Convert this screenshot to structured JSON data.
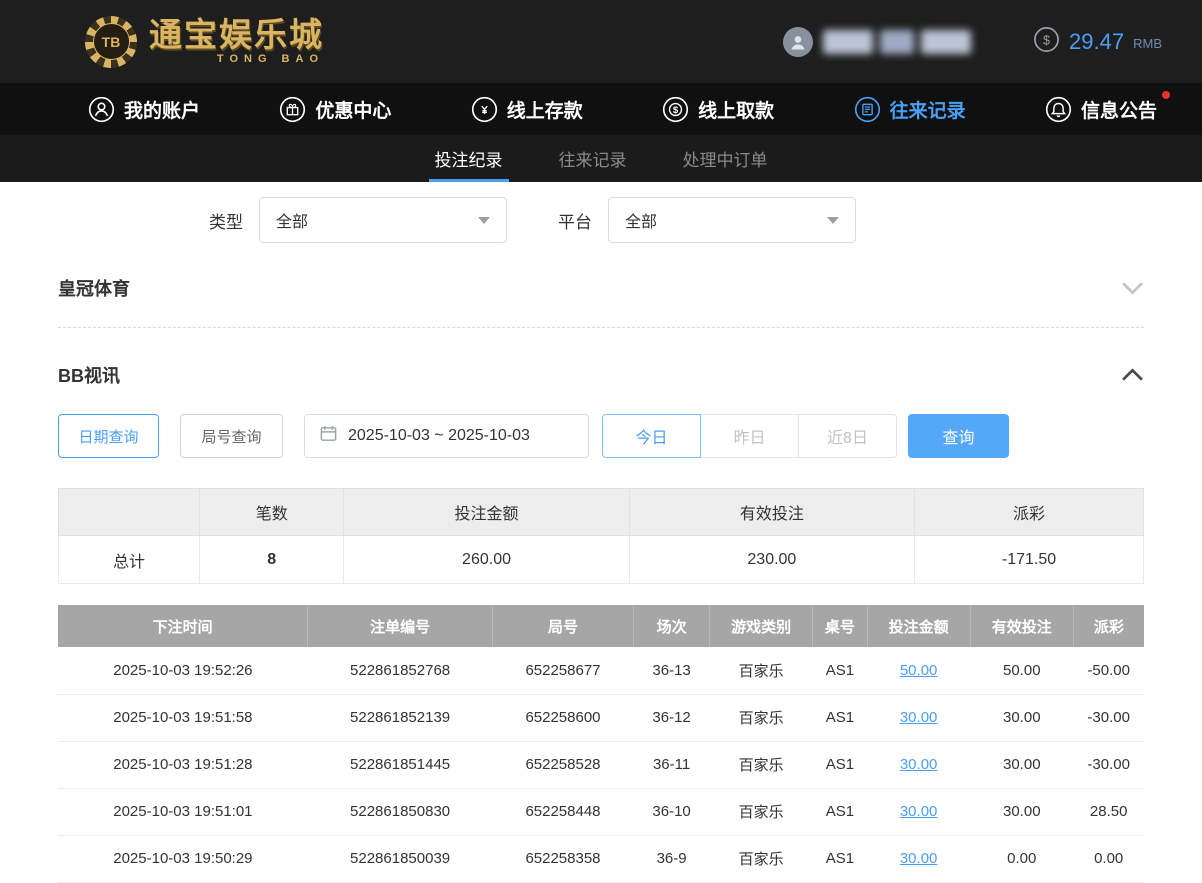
{
  "colors": {
    "accent_blue": "#4a9ff5",
    "negative_red": "#e65a50",
    "brand_gold": "#d9b462"
  },
  "header": {
    "logo_chip": "TB",
    "logo_title": "通宝娱乐城",
    "logo_subtitle": "TONG BAO",
    "balance": "29.47",
    "currency": "RMB"
  },
  "nav": {
    "items": [
      {
        "label": "我的账户"
      },
      {
        "label": "优惠中心"
      },
      {
        "label": "线上存款"
      },
      {
        "label": "线上取款"
      },
      {
        "label": "往来记录"
      },
      {
        "label": "信息公告"
      }
    ]
  },
  "tabs": {
    "items": [
      {
        "label": "投注纪录"
      },
      {
        "label": "往来记录"
      },
      {
        "label": "处理中订单"
      }
    ]
  },
  "filters": {
    "type_label": "类型",
    "type_value": "全部",
    "platform_label": "平台",
    "platform_value": "全部"
  },
  "sections": {
    "crown_title": "皇冠体育",
    "bb_title": "BB视讯"
  },
  "query": {
    "date_query_label": "日期查询",
    "round_query_label": "局号查询",
    "date_range": "2025-10-03 ~ 2025-10-03",
    "today_label": "今日",
    "yesterday_label": "昨日",
    "last8_label": "近8日",
    "search_label": "查询"
  },
  "summary": {
    "headers": [
      "笔数",
      "投注金额",
      "有效投注",
      "派彩"
    ],
    "total_label": "总计",
    "count": "8",
    "bet_amount": "260.00",
    "valid_bet": "230.00",
    "payout": "-171.50"
  },
  "table": {
    "headers": [
      "下注时间",
      "注单编号",
      "局号",
      "场次",
      "游戏类别",
      "桌号",
      "投注金额",
      "有效投注",
      "派彩"
    ],
    "rows": [
      [
        "2025-10-03 19:52:26",
        "522861852768",
        "652258677",
        "36-13",
        "百家乐",
        "AS1",
        "50.00",
        "50.00",
        "-50.00"
      ],
      [
        "2025-10-03 19:51:58",
        "522861852139",
        "652258600",
        "36-12",
        "百家乐",
        "AS1",
        "30.00",
        "30.00",
        "-30.00"
      ],
      [
        "2025-10-03 19:51:28",
        "522861851445",
        "652258528",
        "36-11",
        "百家乐",
        "AS1",
        "30.00",
        "30.00",
        "-30.00"
      ],
      [
        "2025-10-03 19:51:01",
        "522861850830",
        "652258448",
        "36-10",
        "百家乐",
        "AS1",
        "30.00",
        "30.00",
        "28.50"
      ],
      [
        "2025-10-03 19:50:29",
        "522861850039",
        "652258358",
        "36-9",
        "百家乐",
        "AS1",
        "30.00",
        "0.00",
        "0.00"
      ]
    ]
  }
}
